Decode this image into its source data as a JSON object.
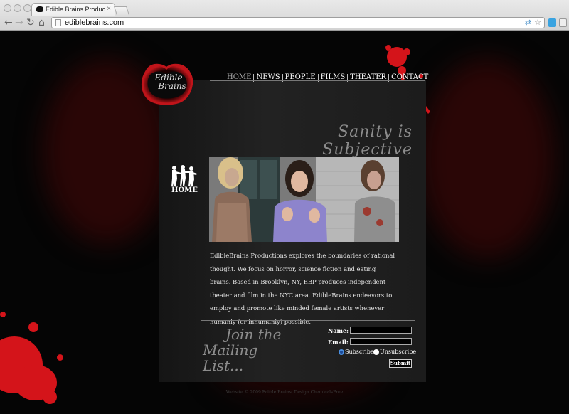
{
  "browser": {
    "tab_title": "Edible Brains Productions",
    "tab_close": "×",
    "url": "ediblebrains.com",
    "back": "←",
    "forward": "→",
    "reload": "↻",
    "home": "⌂",
    "star": "☆"
  },
  "site": {
    "logo_text_line1": "Edible",
    "logo_text_line2": "Brains",
    "nav": [
      "HOME",
      "NEWS",
      "PEOPLE",
      "FILMS",
      "THEATER",
      "CONTACT"
    ],
    "tagline": "Sanity is Subjective",
    "section_label": "HOME",
    "description": "EdibleBrains Productions explores the boundaries of rational thought. We focus on horror, science fiction and eating brains. Based in Brooklyn, NY, EBP produces independent theater and film in the NYC area. EdibleBrains endeavors to employ and promote like minded female artists whenever humanly (or inhumanly) possible.",
    "mailing": {
      "heading_line1": "Join the",
      "heading_line2": "Mailing List...",
      "name_label": "Name:",
      "email_label": "Email:",
      "subscribe_label": "Subscribe",
      "unsubscribe_label": "Unsubscribe",
      "submit_label": "Submit"
    },
    "footer": "Website © 2009 Edible Brains. Design ChemicalsFree",
    "colors": {
      "accent": "#d4141a",
      "panel": "#1c1c1c"
    }
  }
}
